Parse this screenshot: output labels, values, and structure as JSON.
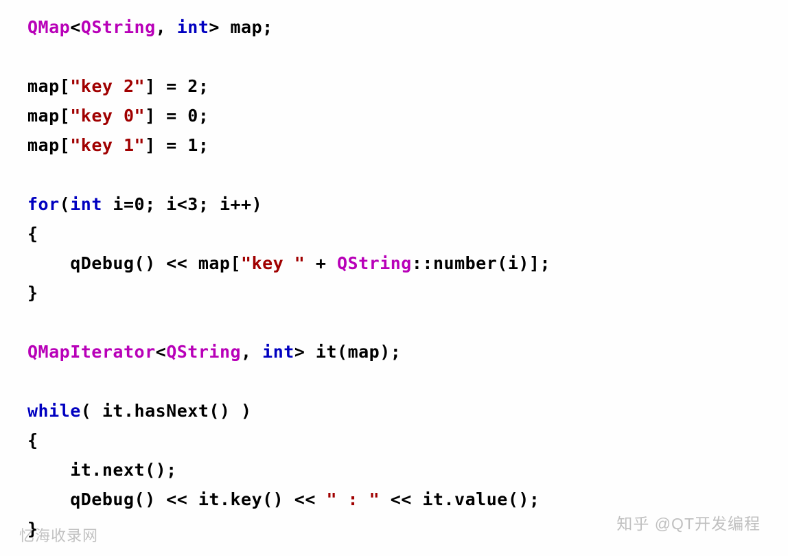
{
  "code": {
    "line1": {
      "qmap": "QMap",
      "lt": "<",
      "qstring": "QString",
      "rest": ", ",
      "int": "int",
      "gt": "> map;"
    },
    "line3": {
      "pre": "map[",
      "str": "\"key 2\"",
      "post": "] = 2;"
    },
    "line4": {
      "pre": "map[",
      "str": "\"key 0\"",
      "post": "] = 0;"
    },
    "line5": {
      "pre": "map[",
      "str": "\"key 1\"",
      "post": "] = 1;"
    },
    "line7": {
      "for": "for",
      "open": "(",
      "int": "int",
      "cond": " i=0; i<3; i++)"
    },
    "line8": {
      "brace": "{"
    },
    "line9": {
      "pad": "    qDebug() << map[",
      "str": "\"key \"",
      "plus": " + ",
      "qs": "QString",
      "tail": "::number(i)];"
    },
    "line10": {
      "brace": "}"
    },
    "line12": {
      "qmi": "QMapIterator",
      "lt": "<",
      "qs": "QString",
      "sep": ", ",
      "int": "int",
      "gt": "> it(map);"
    },
    "line14": {
      "while": "while",
      "rest": "( it.hasNext() )"
    },
    "line15": {
      "brace": "{"
    },
    "line16": {
      "txt": "    it.next();"
    },
    "line17": {
      "pre": "    qDebug() << it.key() << ",
      "str": "\" : \"",
      "post": " << it.value();"
    },
    "line18": {
      "brace": "}"
    }
  },
  "watermark": {
    "left": "忆海收录网",
    "right": "知乎 @QT开发编程"
  }
}
